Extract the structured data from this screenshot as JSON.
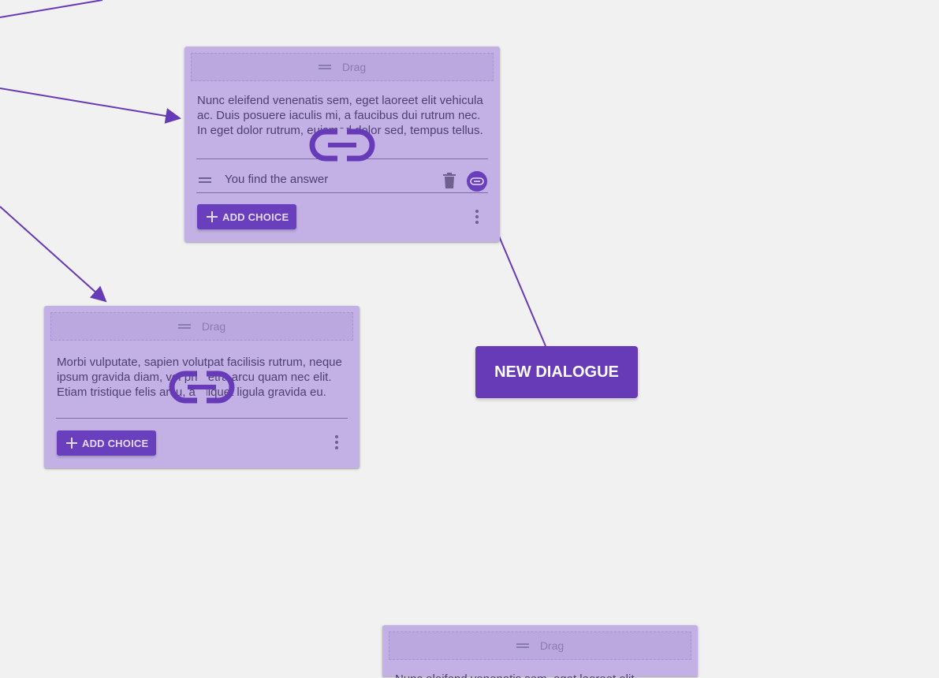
{
  "colors": {
    "background": "#f1f1f1",
    "node_background": "#c3b1e6",
    "accent": "#673ab7",
    "text": "#4f3f6f"
  },
  "nodes": [
    {
      "drag_label": "Drag",
      "text": "Nunc eleifend venenatis sem, eget laoreet elit vehicula ac. Duis posuere iaculis mi, a faucibus dui rutrum nec. In eget dolor rutrum, euismod dolor sed, tempus tellus.",
      "choices": [
        {
          "text": "You find the answer",
          "icons": [
            "delete-icon",
            "link-icon"
          ]
        }
      ],
      "add_choice_label": "ADD CHOICE"
    },
    {
      "drag_label": "Drag",
      "text": "Morbi vulputate, sapien volutpat facilisis rutrum, neque ipsum gravida diam, vel pharetra arcu quam nec elit. Etiam tristique felis arcu, a aliquet ligula gravida eu.",
      "choices": [],
      "add_choice_label": "ADD CHOICE"
    },
    {
      "drag_label": "Drag",
      "text": "Nunc eleifend venenatis sem, eget laoreet elit"
    }
  ],
  "new_dialogue_label": "NEW DIALOGUE",
  "icons": [
    "drag-handle-icon",
    "delete-icon",
    "link-icon",
    "plus-icon",
    "more-vert-icon"
  ]
}
